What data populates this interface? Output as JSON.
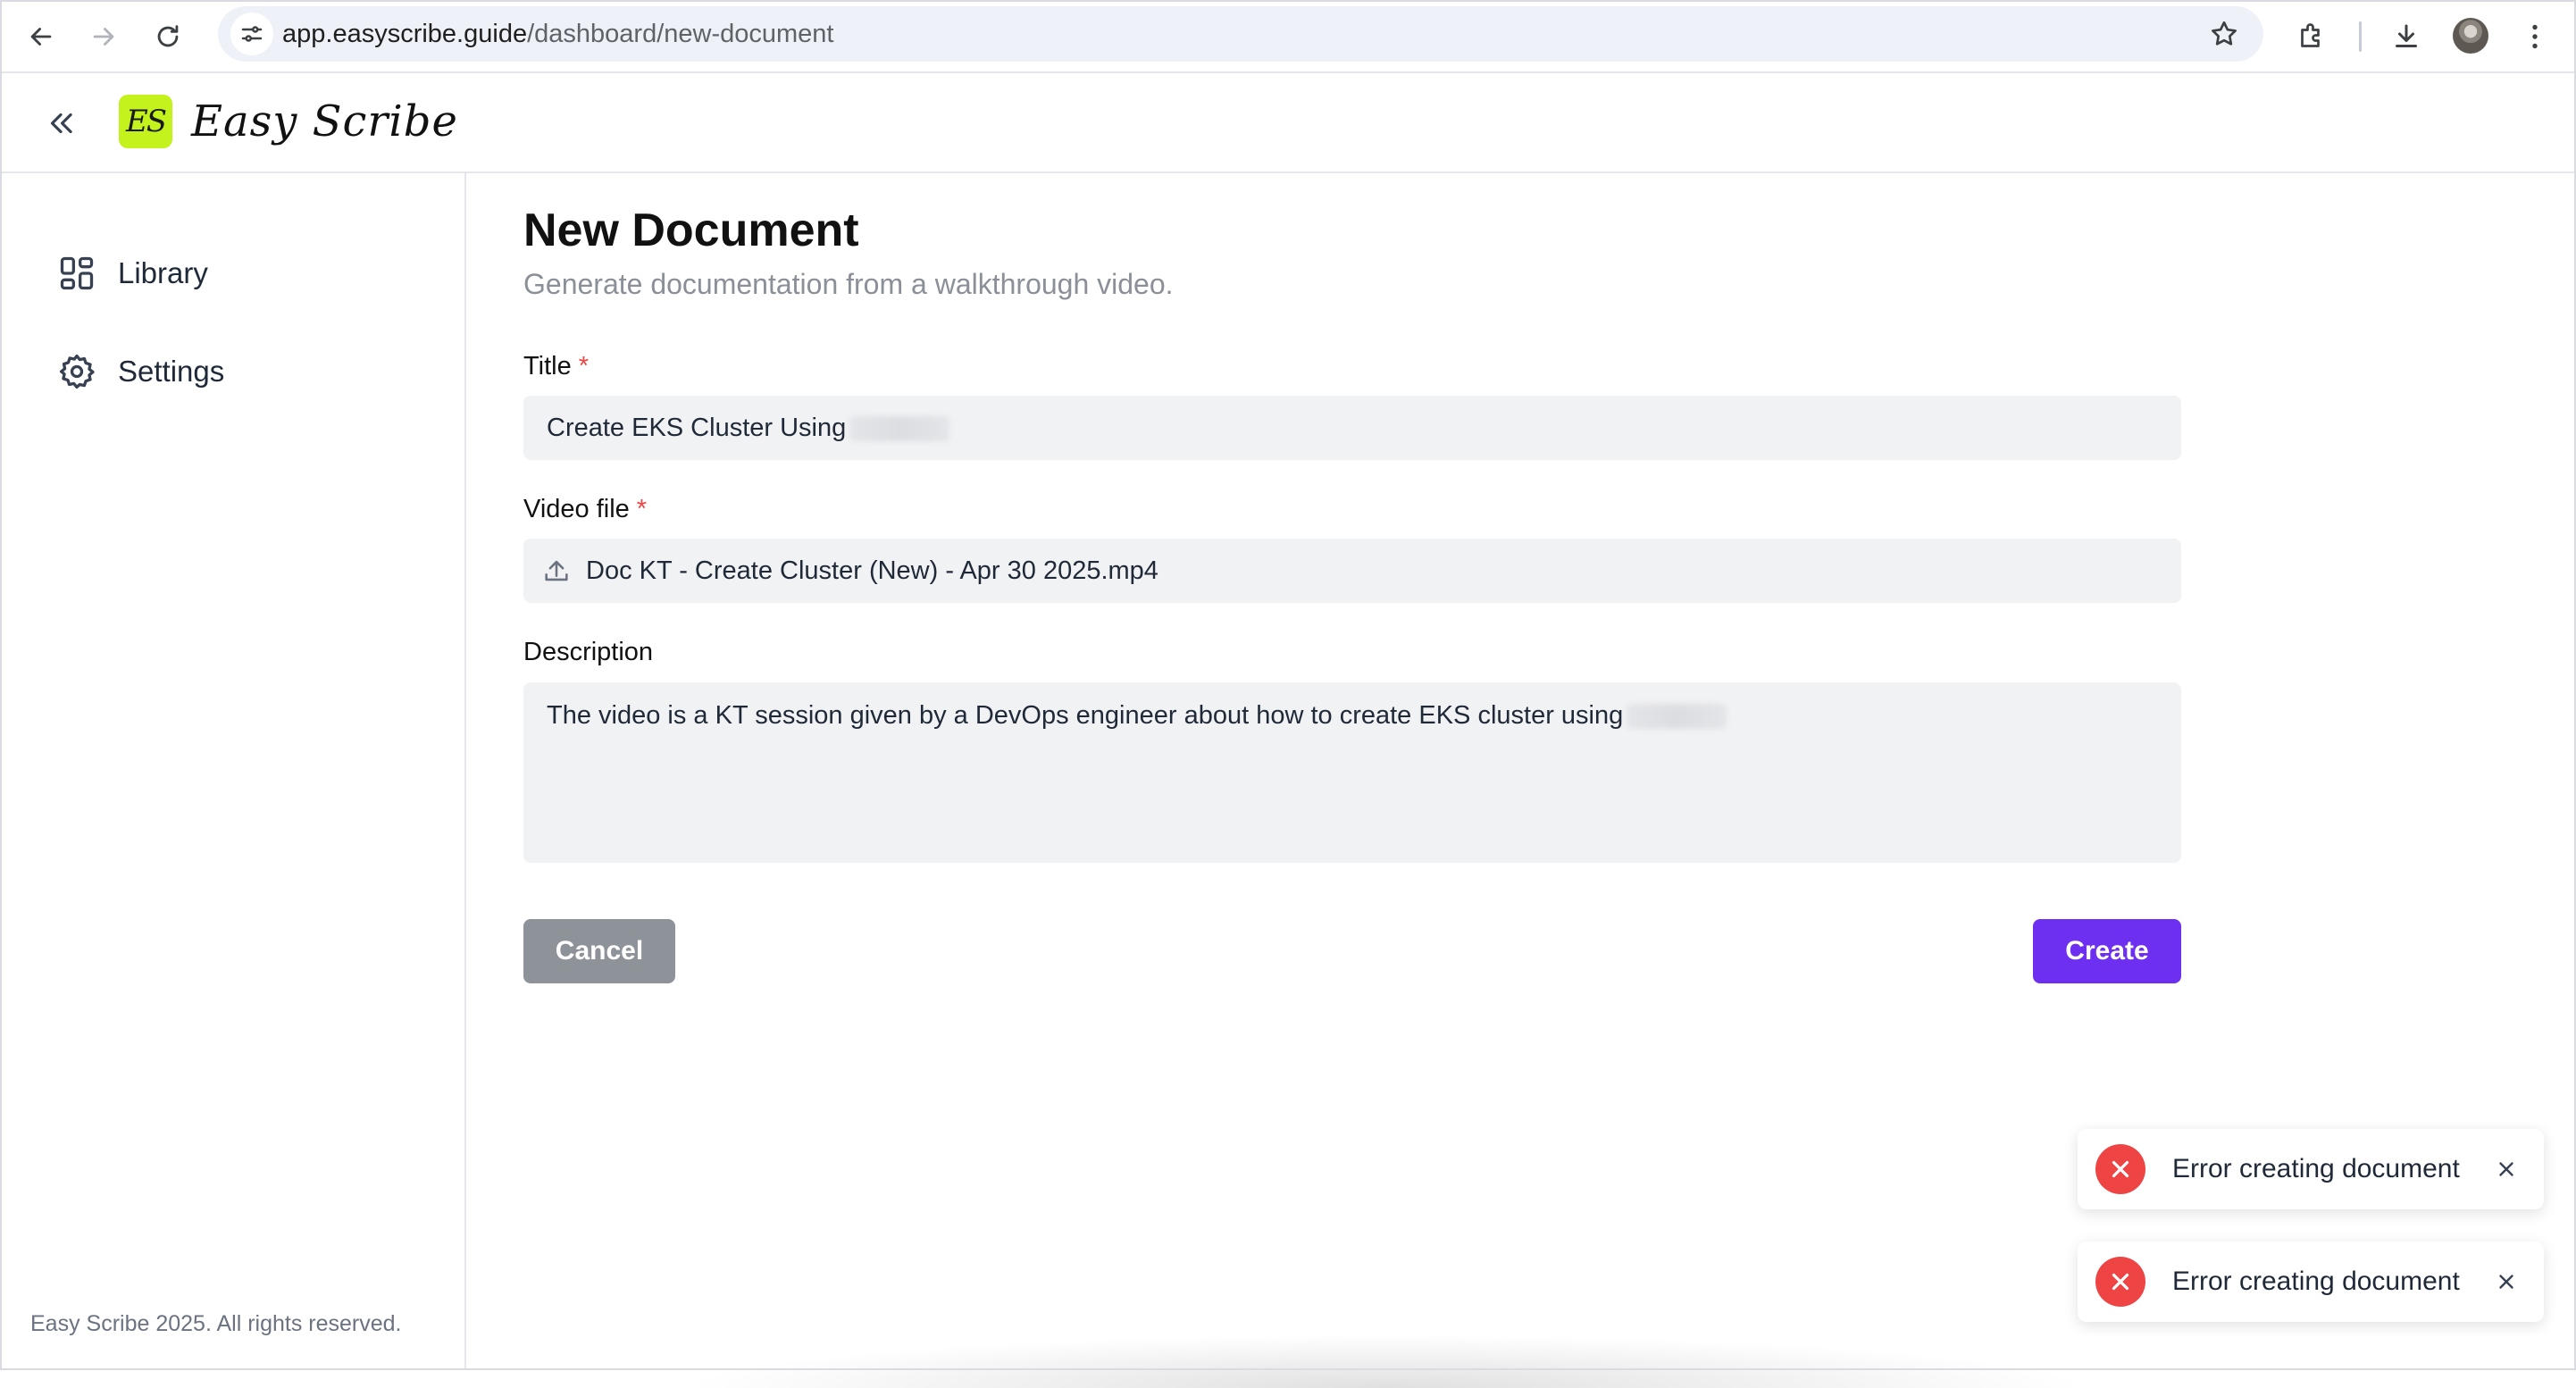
{
  "browser": {
    "url_host": "app.easyscribe.guide",
    "url_path": "/dashboard/new-document"
  },
  "app": {
    "logo_mark": "ES",
    "logo_text": "Easy Scribe"
  },
  "sidebar": {
    "items": [
      {
        "label": "Library",
        "icon": "library-icon"
      },
      {
        "label": "Settings",
        "icon": "gear-icon"
      }
    ],
    "footer": "Easy Scribe 2025. All rights reserved."
  },
  "form": {
    "title": "New Document",
    "subtitle": "Generate documentation from a walkthrough video.",
    "title_label": "Title",
    "title_value": "Create EKS Cluster Using",
    "required_mark": "*",
    "video_label": "Video file",
    "video_value": "Doc KT - Create Cluster (New) - Apr 30 2025.mp4",
    "description_label": "Description",
    "description_value": "The video is a KT session given by a DevOps engineer about how to create EKS cluster using",
    "cancel_label": "Cancel",
    "create_label": "Create"
  },
  "toasts": [
    {
      "message": "Error creating document",
      "status_color": "#ef4444"
    },
    {
      "message": "Error creating document",
      "status_color": "#ef4444"
    }
  ],
  "colors": {
    "accent": "#6d2ff0",
    "logo_bg": "#c4f21d",
    "error": "#ef4444"
  }
}
